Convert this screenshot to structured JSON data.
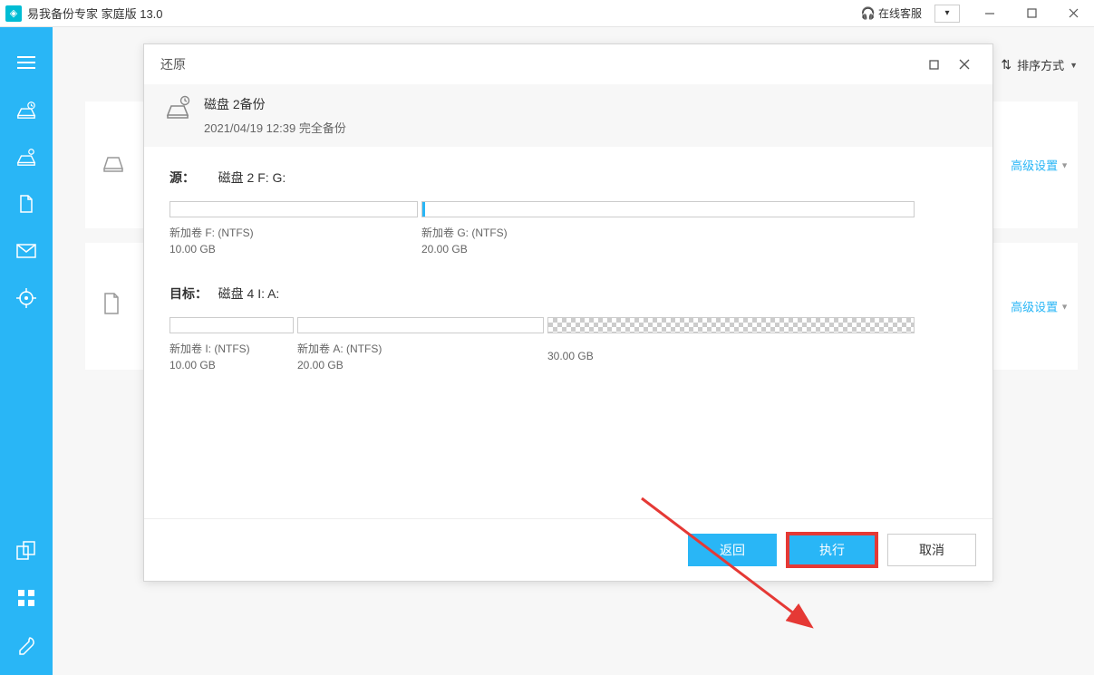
{
  "titlebar": {
    "app_title": "易我备份专家 家庭版 13.0",
    "support": "在线客服"
  },
  "sort": {
    "label": "排序方式"
  },
  "card": {
    "advanced": "高级设置"
  },
  "modal": {
    "title": "还原",
    "header": {
      "name": "磁盘 2备份",
      "subtitle": "2021/04/19 12:39 完全备份"
    },
    "source": {
      "label": "源：",
      "value": "磁盘 2 F: G:",
      "parts": [
        {
          "name": "新加卷 F: (NTFS)",
          "size": "10.00 GB"
        },
        {
          "name": "新加卷 G: (NTFS)",
          "size": "20.00 GB"
        }
      ]
    },
    "target": {
      "label": "目标：",
      "value": "磁盘 4 I: A:",
      "parts": [
        {
          "name": "新加卷 I: (NTFS)",
          "size": "10.00 GB"
        },
        {
          "name": "新加卷 A: (NTFS)",
          "size": "20.00 GB"
        },
        {
          "name": "",
          "size": "30.00 GB"
        }
      ]
    },
    "footer": {
      "back": "返回",
      "proceed": "执行",
      "cancel": "取消"
    }
  }
}
